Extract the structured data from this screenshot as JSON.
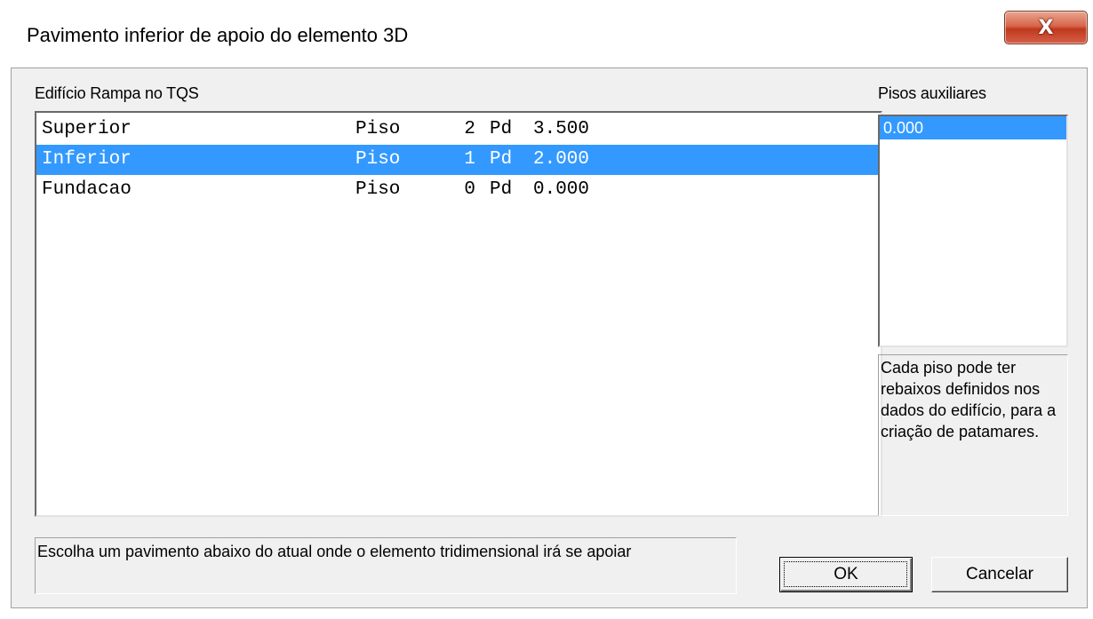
{
  "window": {
    "title": "Pavimento inferior de apoio do elemento 3D",
    "close_glyph": "X"
  },
  "main_list": {
    "label": "Edifício Rampa no TQS",
    "rows": [
      {
        "name": "Superior",
        "type": "Piso",
        "num": "2",
        "pd": "Pd",
        "value": "3.500",
        "selected": false
      },
      {
        "name": "Inferior",
        "type": "Piso",
        "num": "1",
        "pd": "Pd",
        "value": "2.000",
        "selected": true
      },
      {
        "name": "Fundacao",
        "type": "Piso",
        "num": "0",
        "pd": "Pd",
        "value": "0.000",
        "selected": false
      }
    ]
  },
  "aux_list": {
    "label": "Pisos auxiliares",
    "items": [
      "0.000"
    ]
  },
  "info_text": "Cada piso pode ter rebaixos definidos nos dados do edifício, para a criação de patamares.",
  "status_text": "Escolha um pavimento abaixo do atual onde o elemento tridimensional irá se apoiar",
  "buttons": {
    "ok": "OK",
    "cancel": "Cancelar"
  },
  "colors": {
    "selection": "#3399ff",
    "dialog_bg": "#f0f0f0",
    "close_button": "#c0391c"
  }
}
